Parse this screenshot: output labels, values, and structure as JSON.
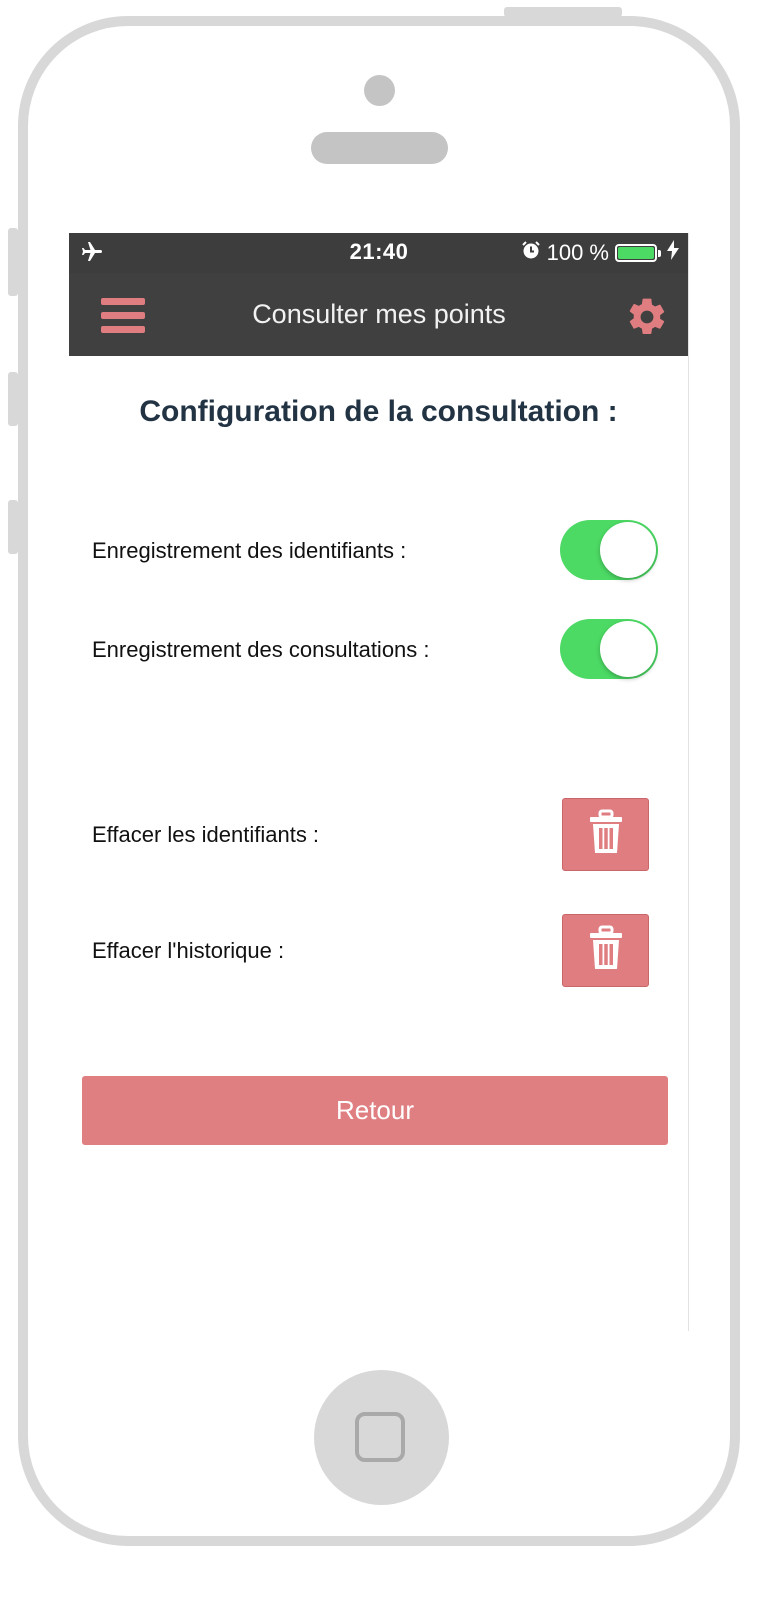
{
  "status_bar": {
    "time": "21:40",
    "battery_text": "100 %",
    "battery_level": 100,
    "icons": [
      "airplane-icon",
      "alarm-icon",
      "battery-icon",
      "charging-bolt-icon"
    ]
  },
  "nav": {
    "title": "Consulter mes points",
    "menu_icon": "hamburger-menu-icon",
    "settings_icon": "gear-icon"
  },
  "page": {
    "heading": "Configuration de la consultation :"
  },
  "toggles": [
    {
      "label": "Enregistrement des identifiants :",
      "state": "on"
    },
    {
      "label": "Enregistrement des consultations :",
      "state": "on"
    }
  ],
  "delete_actions": [
    {
      "label": "Effacer les identifiants :",
      "icon": "trash-icon"
    },
    {
      "label": "Effacer l'historique :",
      "icon": "trash-icon"
    }
  ],
  "back_button": {
    "label": "Retour"
  },
  "colors": {
    "accent": "#e07d80",
    "toggle_on": "#4cd964",
    "navbar": "#404040",
    "heading": "#223344"
  }
}
